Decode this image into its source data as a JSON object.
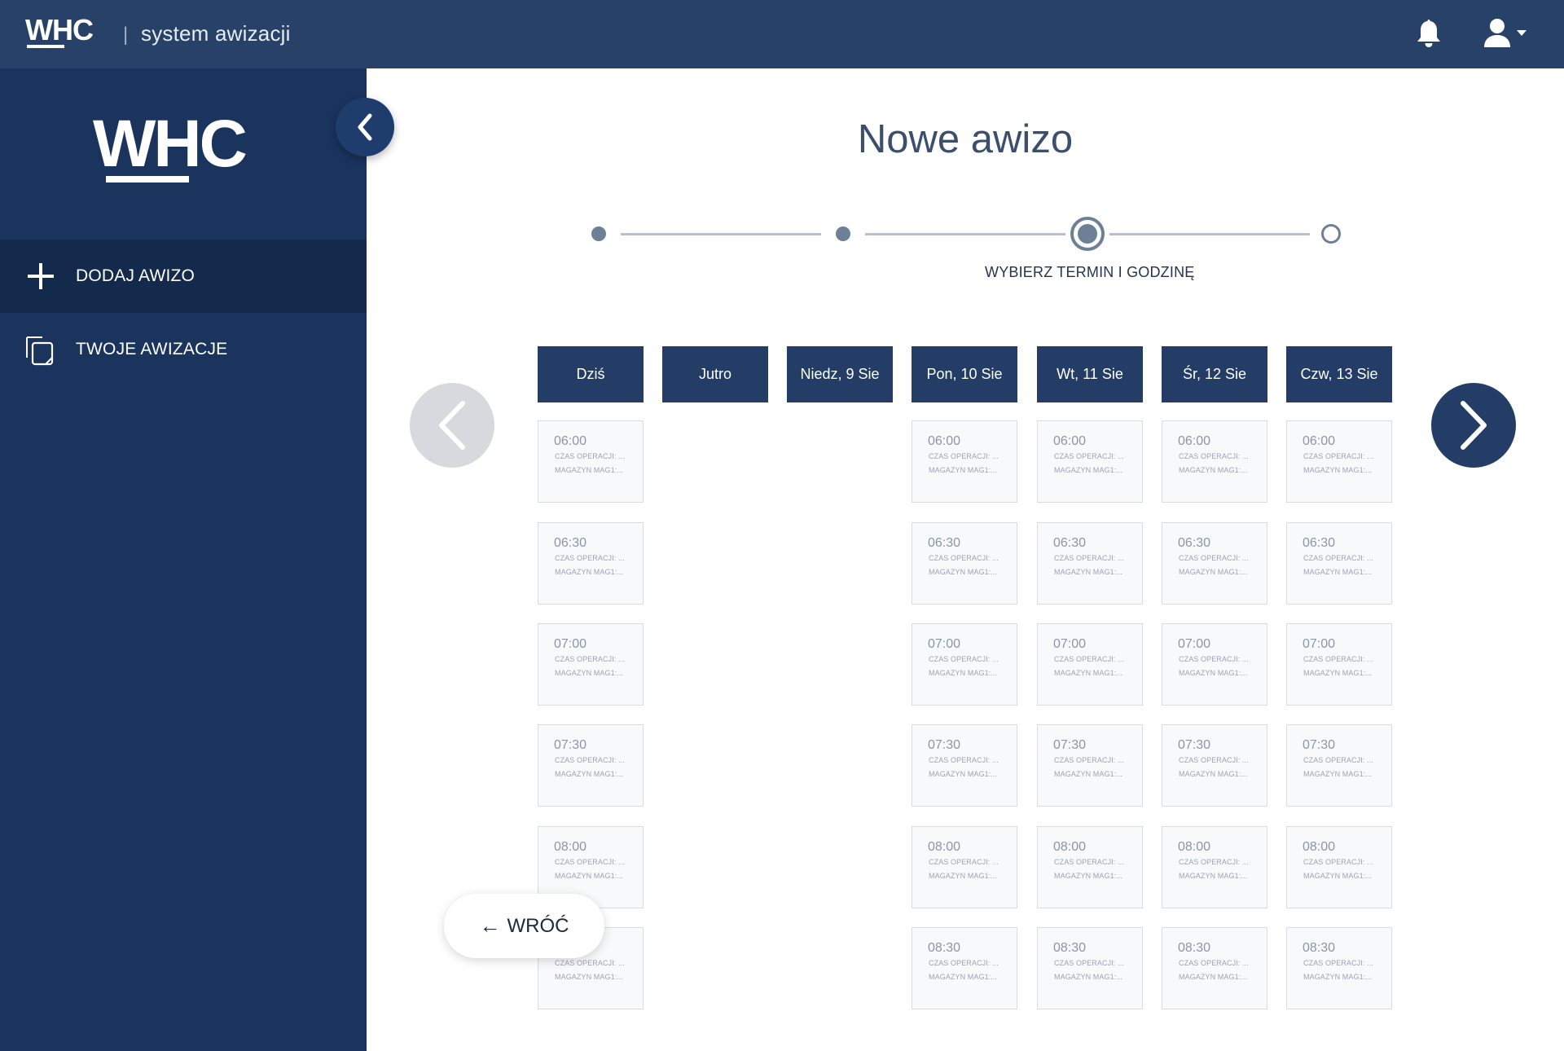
{
  "topbar": {
    "logo_text": "WHC",
    "separator": "|",
    "subtitle": "system awizacji",
    "bell_icon": "bell-icon",
    "user_icon": "user-icon",
    "accent": "#274168"
  },
  "sidebar": {
    "logo_text": "WHC",
    "collapse_icon": "chevron-left-icon",
    "items": [
      {
        "label": "DODAJ AWIZO",
        "icon": "plus-icon",
        "active": true
      },
      {
        "label": "TWOJE AWIZACJE",
        "icon": "documents-icon",
        "active": false
      }
    ],
    "background": "#1a345e"
  },
  "main": {
    "title": "Nowe awizo",
    "stepper": {
      "steps": 4,
      "current": 3,
      "current_label": "WYBIERZ TERMIN I GODZINĘ"
    },
    "days": [
      "Dziś",
      "Jutro",
      "Niedz, 9 Sie",
      "Pon, 10 Sie",
      "Wt, 11 Sie",
      "Śr, 12 Sie",
      "Czw, 13 Sie"
    ],
    "slot_text": {
      "op": "CZAS OPERACJI: ...",
      "mag": "MAGAZYN MAG1:..."
    },
    "columns": [
      {
        "day": "Dziś",
        "slots": [
          "06:00",
          "06:30",
          "07:00",
          "07:30",
          "08:00",
          ""
        ]
      },
      {
        "day": "Jutro",
        "slots": []
      },
      {
        "day": "Niedz, 9 Sie",
        "slots": []
      },
      {
        "day": "Pon, 10 Sie",
        "slots": [
          "06:00",
          "06:30",
          "07:00",
          "07:30",
          "08:00",
          "08:30"
        ]
      },
      {
        "day": "Wt, 11 Sie",
        "slots": [
          "06:00",
          "06:30",
          "07:00",
          "07:30",
          "08:00",
          "08:30"
        ]
      },
      {
        "day": "Śr, 12 Sie",
        "slots": [
          "06:00",
          "06:30",
          "07:00",
          "07:30",
          "08:00",
          "08:30"
        ]
      },
      {
        "day": "Czw, 13 Sie",
        "slots": [
          "06:00",
          "06:30",
          "07:00",
          "07:30",
          "08:00",
          "08:30"
        ]
      }
    ],
    "prev_icon": "chevron-left-icon",
    "next_icon": "chevron-right-icon",
    "back_button": {
      "arrow": "←",
      "label": "WRÓĆ"
    }
  }
}
